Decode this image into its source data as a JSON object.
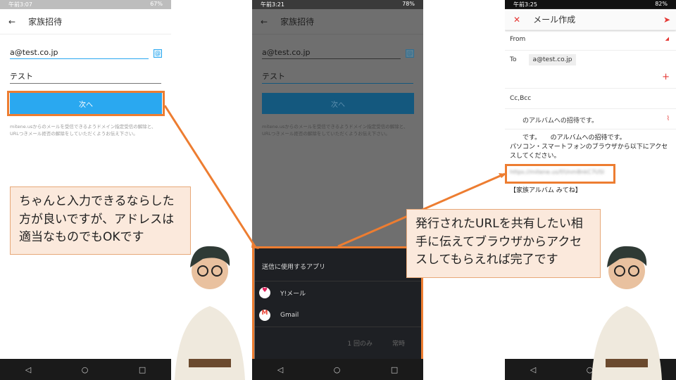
{
  "phone1": {
    "status_time": "午前3:07",
    "battery": "67%",
    "title": "家族招待",
    "email_value": "a@test.co.jp",
    "name_value": "テスト",
    "next_label": "次へ",
    "note": "mitene.usからのメールを受信できるようドメイン指定受信の解除と、URLつきメール拒否の解除をしていただくようお伝え下さい。"
  },
  "phone2": {
    "status_time": "午前3:21",
    "battery": "78%",
    "title": "家族招待",
    "email_value": "a@test.co.jp",
    "name_value": "テスト",
    "next_label": "次へ",
    "note": "mitene.usからのメールを受信できるようドメイン指定受信の解除と、URLつきメール拒否の解除をしていただくようお伝え下さい。",
    "sheet_title": "送信に使用するアプリ",
    "apps": [
      {
        "label": "Y!メール",
        "icon": "yahoo-mail-icon"
      },
      {
        "label": "Gmail",
        "icon": "gmail-icon"
      }
    ],
    "once_label": "1 回のみ",
    "always_label": "常時"
  },
  "phone3": {
    "status_time": "午前3:25",
    "battery": "82%",
    "title": "メール作成",
    "from_label": "From",
    "to_label": "To",
    "to_chip": "a@test.co.jp",
    "ccbcc_label": "Cc,Bcc",
    "subject": "　　のアルバムへの招待です。",
    "body_line1": "　　です。　　のアルバムへの招待です。",
    "body_line2": "パソコン・スマートフォンのブラウザから以下にアクセスしてください。",
    "url_blurred": "https://mitene.us/f/Unm8nkC7USl",
    "signature": "【家族アルバム みてね】"
  },
  "callouts": {
    "left": "ちゃんと入力できるならした方が良いですが、アドレスは適当なものでもOKです",
    "right": "発行されたURLを共有したい相手に伝えてブラウザからアクセスしてもらえれば完了です"
  },
  "colors": {
    "accent_orange": "#ed7d31",
    "button_blue": "#2aa8f0",
    "callout_bg": "#fbe9dc"
  }
}
